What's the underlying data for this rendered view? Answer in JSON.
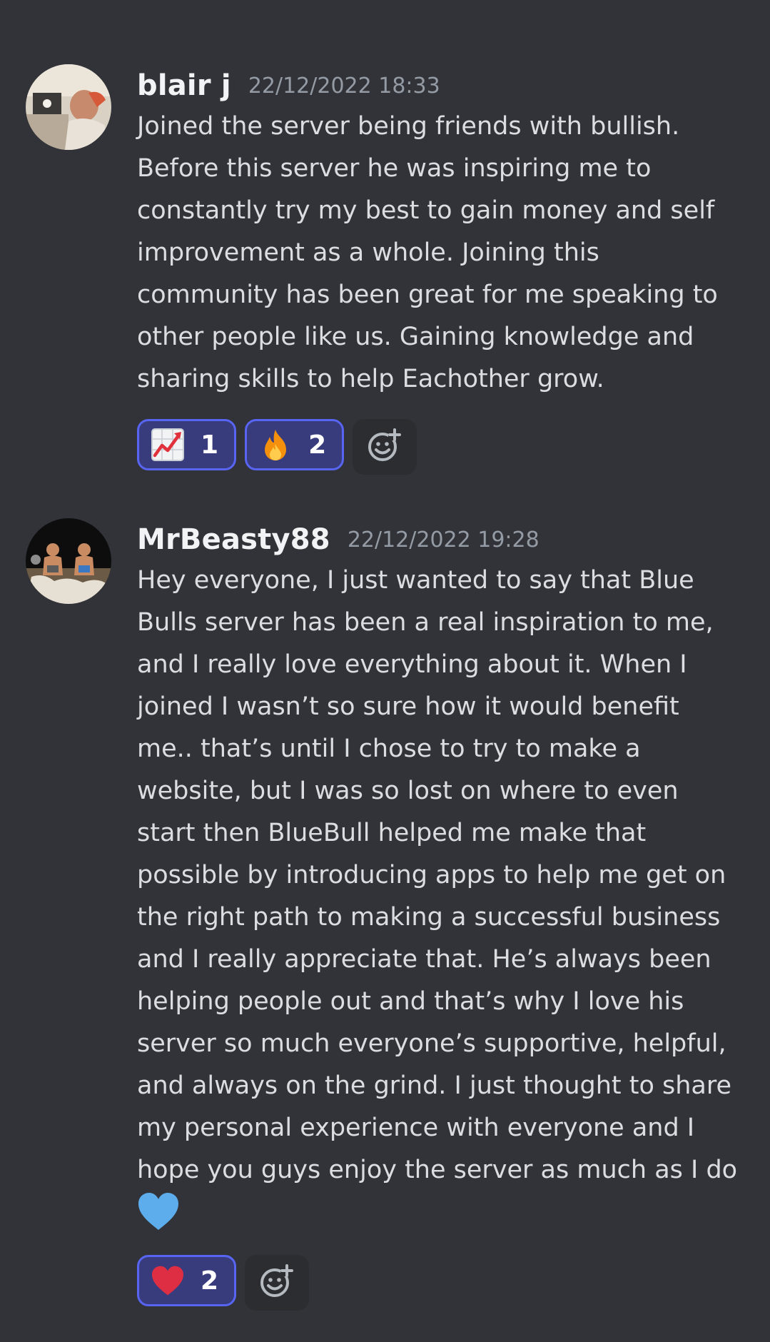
{
  "messages": [
    {
      "username": "blair j",
      "timestamp": "22/12/2022 18:33",
      "lines": [
        "Joined the server being friends with bullish.",
        "Before this server he was inspiring me to",
        "constantly try my best to gain money and self",
        "improvement as a whole. Joining this",
        "community has been great for me speaking to",
        "other people like us. Gaining knowledge and",
        "sharing skills to help Eachother grow."
      ],
      "reactions": [
        {
          "icon": "chart-increasing-icon",
          "count": "1"
        },
        {
          "icon": "fire-icon",
          "count": "2"
        }
      ]
    },
    {
      "username": "MrBeasty88",
      "timestamp": "22/12/2022 19:28",
      "lines": [
        "Hey everyone, I just wanted to say that Blue",
        "Bulls server has been a real inspiration to me,",
        "and I really love everything about it. When I",
        "joined I wasn’t so sure how it would benefit",
        "me.. that’s until I chose to try to make a",
        "website, but I was so lost on where to even",
        "start then BlueBull helped me make that",
        "possible by introducing apps to help me get on",
        "the right path to making a successful business",
        "and I really appreciate that. He’s always been",
        "helping people out and that’s why I love his",
        "server so much everyone’s supportive, helpful,",
        "and always on the grind. I just thought to share",
        "my personal experience with everyone and I",
        "hope you guys enjoy the server as much as I do"
      ],
      "trailing_emoji": "blue-heart-icon",
      "reactions": [
        {
          "icon": "red-heart-icon",
          "count": "2"
        }
      ]
    }
  ],
  "colors": {
    "background": "#313338",
    "reaction_active_bg": "#383c7d",
    "reaction_active_border": "#5865f2",
    "timestamp": "#949ba4",
    "username": "#f2f3f5"
  }
}
